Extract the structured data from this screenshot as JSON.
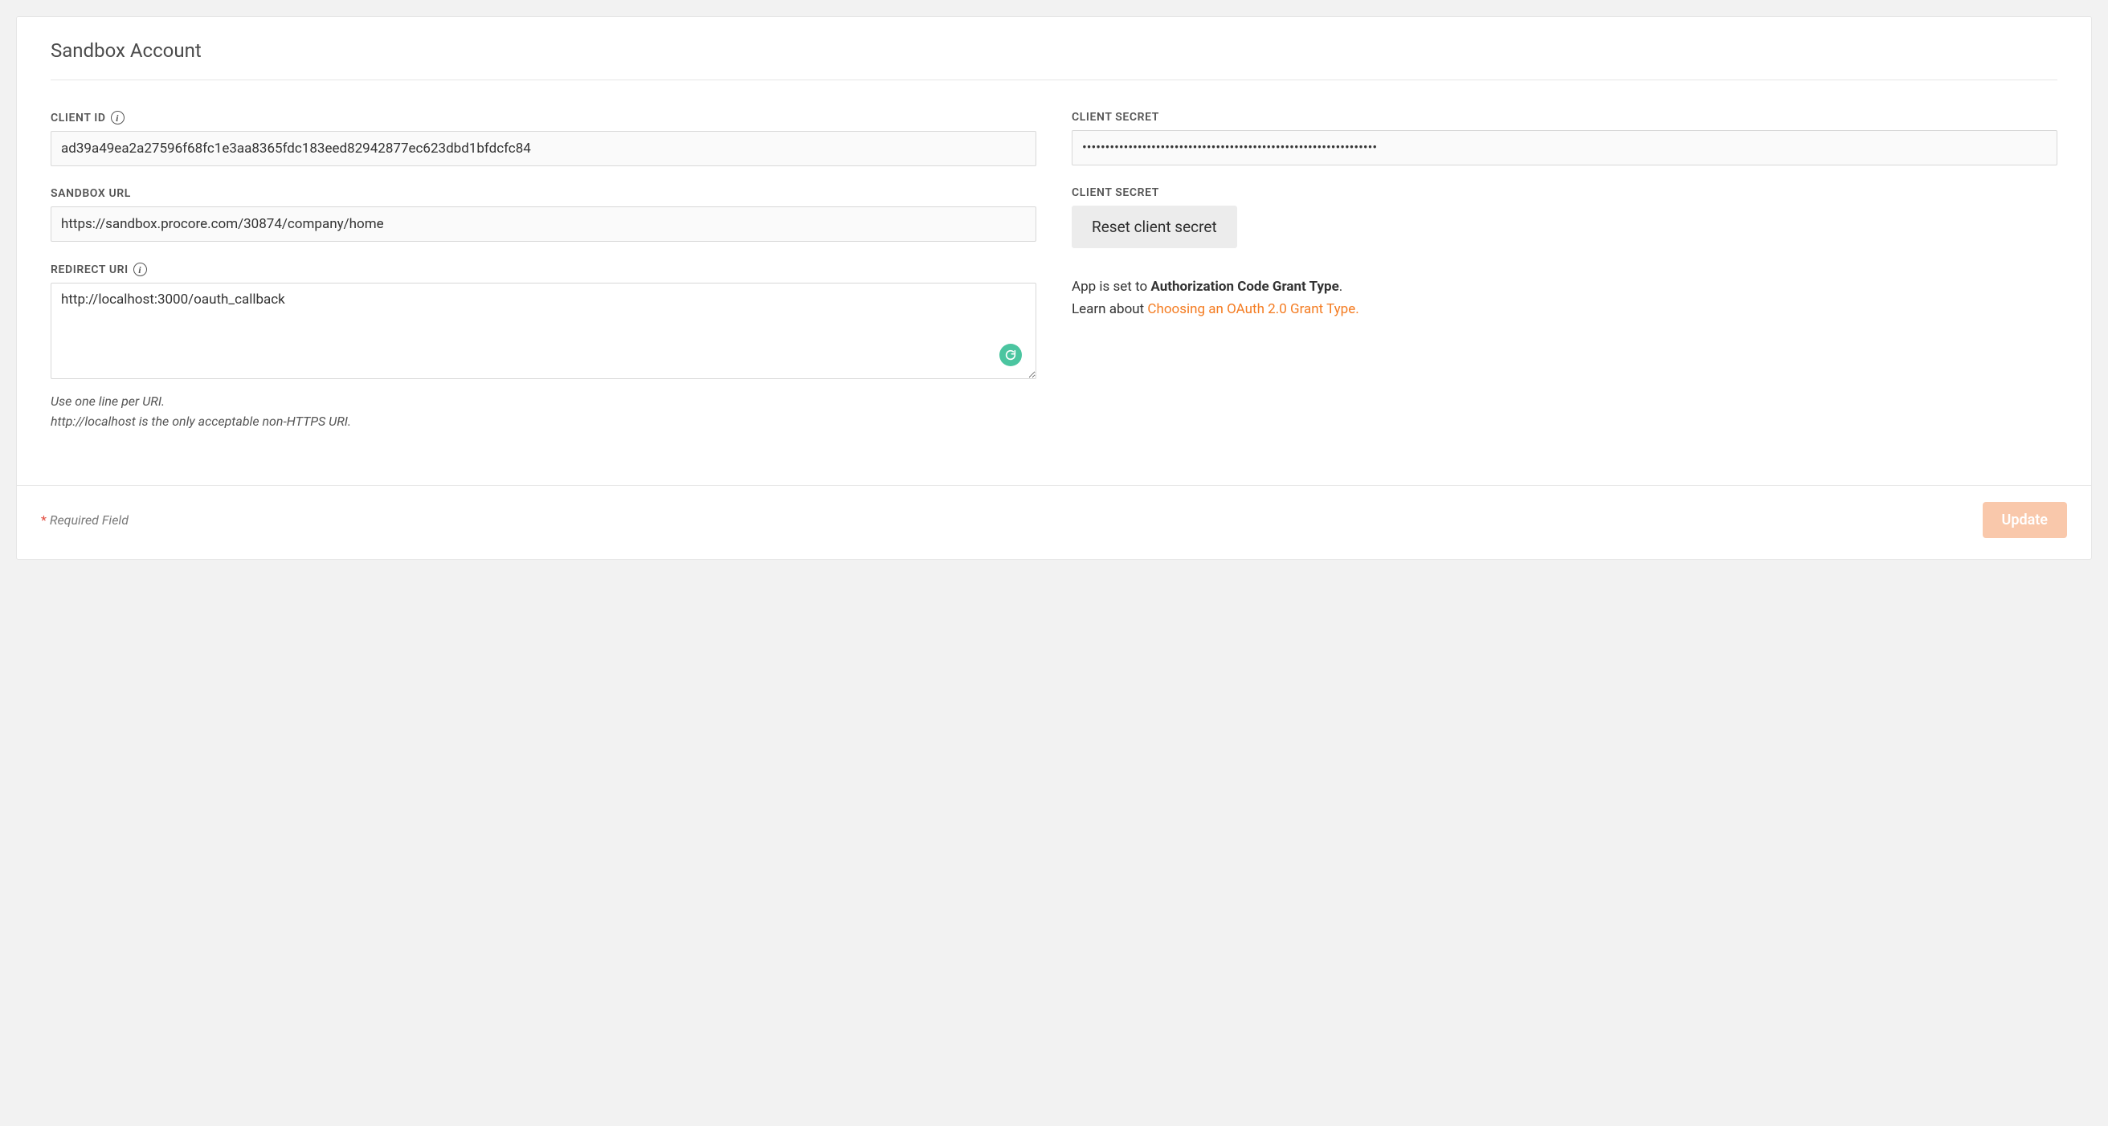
{
  "card": {
    "title": "Sandbox Account"
  },
  "left": {
    "client_id": {
      "label": "CLIENT ID",
      "value": "ad39a49ea2a27596f68fc1e3aa8365fdc183eed82942877ec623dbd1bfdcfc84"
    },
    "sandbox_url": {
      "label": "SANDBOX URL",
      "value": "https://sandbox.procore.com/30874/company/home"
    },
    "redirect_uri": {
      "label": "REDIRECT URI",
      "value": "http://localhost:3000/oauth_callback",
      "hint_line1": "Use one line per URI.",
      "hint_line2": "http://localhost is the only acceptable non-HTTPS URI."
    }
  },
  "right": {
    "client_secret": {
      "label": "CLIENT SECRET",
      "value": "••••••••••••••••••••••••••••••••••••••••••••••••••••••••••••••••"
    },
    "reset": {
      "label": "CLIENT SECRET",
      "button": "Reset client secret"
    },
    "info": {
      "prefix": "App is set to ",
      "bold": "Authorization Code Grant Type",
      "suffix": ".",
      "learn_prefix": "Learn about ",
      "link_text": "Choosing an OAuth 2.0 Grant Type."
    }
  },
  "footer": {
    "required": "Required Field",
    "update": "Update"
  }
}
